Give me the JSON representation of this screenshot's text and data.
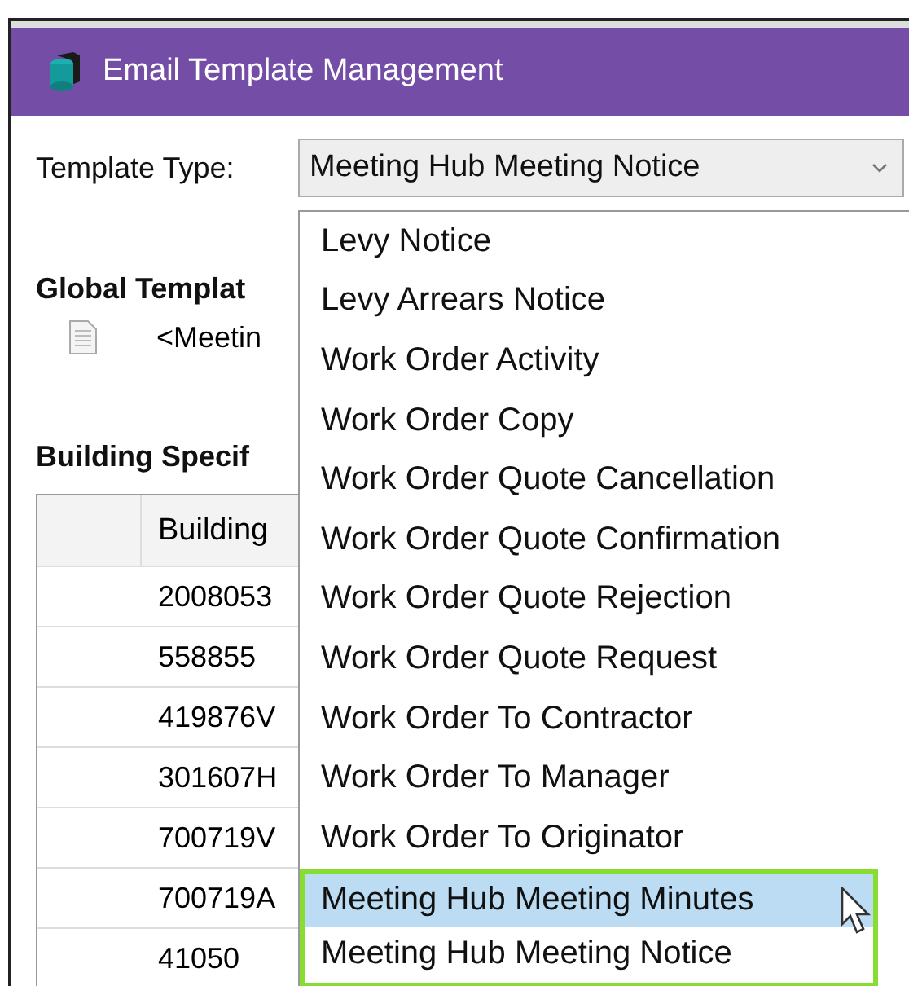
{
  "window": {
    "title": "Email Template Management"
  },
  "template_type": {
    "label": "Template Type:",
    "value": "Meeting Hub Meeting Notice",
    "expanded": true
  },
  "dropdown_items": [
    {
      "label": "Levy Notice",
      "selected": false,
      "outlined": false
    },
    {
      "label": "Levy Arrears Notice",
      "selected": false,
      "outlined": false
    },
    {
      "label": "Work Order Activity",
      "selected": false,
      "outlined": false
    },
    {
      "label": "Work Order Copy",
      "selected": false,
      "outlined": false
    },
    {
      "label": "Work Order Quote Cancellation",
      "selected": false,
      "outlined": false
    },
    {
      "label": "Work Order Quote Confirmation",
      "selected": false,
      "outlined": false
    },
    {
      "label": "Work Order Quote Rejection",
      "selected": false,
      "outlined": false
    },
    {
      "label": "Work Order Quote Request",
      "selected": false,
      "outlined": false
    },
    {
      "label": "Work Order To Contractor",
      "selected": false,
      "outlined": false
    },
    {
      "label": "Work Order To Manager",
      "selected": false,
      "outlined": false
    },
    {
      "label": "Work Order To Originator",
      "selected": false,
      "outlined": false
    },
    {
      "label": "Meeting Hub Meeting Minutes",
      "selected": true,
      "outlined": true
    },
    {
      "label": "Meeting Hub Meeting Notice",
      "selected": false,
      "outlined": true
    }
  ],
  "global_templates": {
    "heading": "Global Templat",
    "items": [
      "<Meetin"
    ]
  },
  "building_specific": {
    "heading": "Building Specif",
    "columns": [
      "Building"
    ],
    "rows": [
      "2008053",
      "558855",
      "419876V",
      "301607H",
      "700719V",
      "700719A",
      "41050"
    ]
  }
}
